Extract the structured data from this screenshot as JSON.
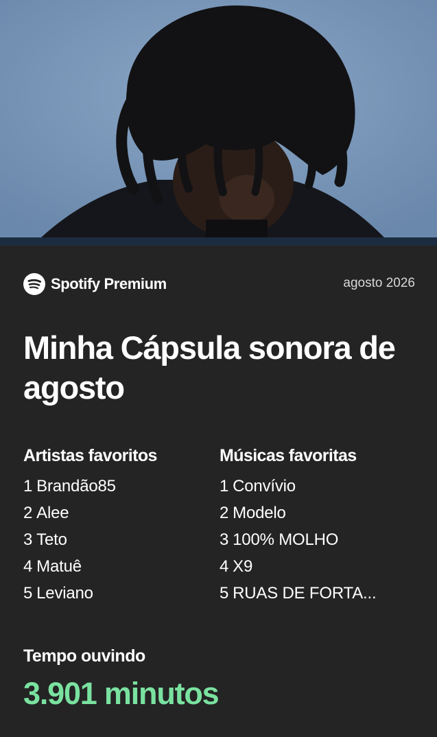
{
  "header": {
    "brand": "Spotify Premium",
    "period": "agosto 2026"
  },
  "title": "Minha Cápsula sonora de agosto",
  "artists": {
    "heading": "Artistas favoritos",
    "items": [
      {
        "rank": "1",
        "name": "Brandão85"
      },
      {
        "rank": "2",
        "name": "Alee"
      },
      {
        "rank": "3",
        "name": "Teto"
      },
      {
        "rank": "4",
        "name": "Matuê"
      },
      {
        "rank": "5",
        "name": "Leviano"
      }
    ]
  },
  "songs": {
    "heading": "Músicas favoritas",
    "items": [
      {
        "rank": "1",
        "name": "Convívio"
      },
      {
        "rank": "2",
        "name": "Modelo"
      },
      {
        "rank": "3",
        "name": "100% MOLHO"
      },
      {
        "rank": "4",
        "name": "X9"
      },
      {
        "rank": "5",
        "name": "RUAS DE FORTA..."
      }
    ]
  },
  "listening": {
    "label": "Tempo ouvindo",
    "value": "3.901 minutos",
    "accent_color": "#1ed760"
  },
  "colors": {
    "background": "#242424",
    "cover_sky": "#7d9bbd",
    "strip": "#1c2c40",
    "accent_text": "#7ae2a0"
  }
}
